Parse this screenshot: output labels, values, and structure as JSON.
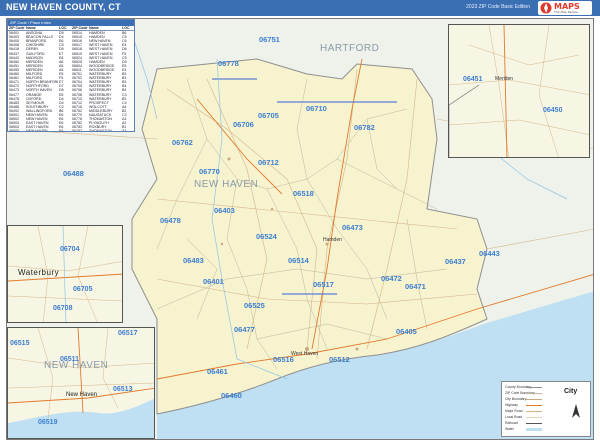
{
  "header": {
    "title": "NEW HAVEN COUNTY, CT",
    "subtitle": "2023 ZIP Code Basic Edition",
    "logo_word": "MAPS",
    "logo_tagline": "The Map People"
  },
  "colors": {
    "header": "#3a6fb3",
    "county_fill": "#f7f3cf",
    "outside_fill": "#eef2ea",
    "water": "#bfe0f2",
    "zip_label": "#3d7fd1",
    "roads": "#d4b48a",
    "boundary": "#8f8f8f"
  },
  "map": {
    "region_labels": {
      "county": "NEW HAVEN",
      "hartford": "HARTFORD",
      "meriden": "Meriden",
      "waterbury": "Waterbury",
      "hamden": "Hamden",
      "west_haven": "West Haven",
      "new_haven": "New Haven"
    },
    "zip_labels": [
      "06751",
      "06705",
      "06710",
      "06778",
      "06706",
      "06762",
      "06782",
      "06770",
      "06712",
      "06488",
      "06518",
      "06403",
      "06478",
      "06483",
      "06524",
      "06514",
      "06473",
      "06401",
      "06517",
      "06472",
      "06525",
      "06471",
      "06477",
      "06405",
      "06516",
      "06512",
      "06461",
      "06437",
      "06443",
      "06450",
      "06451",
      "06460"
    ],
    "inset_zip_labels": {
      "meriden": [
        "06451",
        "06450"
      ],
      "waterbury": [
        "06704",
        "06705",
        "06708"
      ],
      "new_haven": [
        "06515",
        "06517",
        "06511",
        "06513",
        "06519"
      ]
    }
  },
  "zip_table": {
    "title": "ZIP Code / Place Index",
    "columns": [
      "ZIP Code",
      "Name",
      "LOC",
      "ZIP Code",
      "Name",
      "LOC"
    ],
    "rows": [
      [
        "06401",
        "ANSONIA",
        "D5",
        "06514",
        "HAMDEN",
        "B6"
      ],
      [
        "06403",
        "BEACON FALLS",
        "D4",
        "06515",
        "HAMDEN",
        "C5"
      ],
      [
        "06405",
        "BRANFORD",
        "E6",
        "06516",
        "NEW HAVEN",
        "C6"
      ],
      [
        "06408",
        "CHESHIRE",
        "C5",
        "06517",
        "WEST HAVEN",
        "E4"
      ],
      [
        "06418",
        "DERBY",
        "D5",
        "06518",
        "WEST HAVEN",
        "D6"
      ],
      [
        "06437",
        "GUILFORD",
        "E7",
        "06519",
        "WEST HAVEN",
        "F5"
      ],
      [
        "06443",
        "MADISON",
        "E8",
        "06524",
        "WEST HAVEN",
        "C5"
      ],
      [
        "06450",
        "MERIDEN",
        "A6",
        "06525",
        "HAMDEN",
        "D5"
      ],
      [
        "06451",
        "MERIDEN",
        "A5",
        "06604",
        "WOODBRIDGE",
        "E5"
      ],
      [
        "06455",
        "MERIDEN",
        "A5",
        "06611",
        "WOODBRIDGE",
        "E4"
      ],
      [
        "06460",
        "MILFORD",
        "E5",
        "06701",
        "WATERBURY",
        "B3"
      ],
      [
        "06461",
        "MILFORD",
        "F5",
        "06702",
        "WATERBURY",
        "B3"
      ],
      [
        "06471",
        "NORTH BRANFORD",
        "E7",
        "06704",
        "WATERBURY",
        "B3"
      ],
      [
        "06472",
        "NORTHFORD",
        "D7",
        "06705",
        "WATERBURY",
        "B4"
      ],
      [
        "06473",
        "NORTH HAVEN",
        "D6",
        "06706",
        "WATERBURY",
        "B4"
      ],
      [
        "06477",
        "ORANGE",
        "E5",
        "06708",
        "WATERBURY",
        "C3"
      ],
      [
        "06478",
        "OXFORD",
        "D4",
        "06710",
        "WATERBURY",
        "B3"
      ],
      [
        "06483",
        "SEYMOUR",
        "D4",
        "06712",
        "PROSPECT",
        "C4"
      ],
      [
        "06488",
        "SOUTHBURY",
        "C2",
        "06716",
        "WOLCOTT",
        "A4"
      ],
      [
        "06492",
        "WALLINGFORD",
        "B6",
        "06762",
        "MIDDLEBURY",
        "B2"
      ],
      [
        "06501",
        "NEW HAVEN",
        "E6",
        "06770",
        "NAUGATUCK",
        "C3"
      ],
      [
        "06502",
        "NEW HAVEN",
        "E6",
        "06778",
        "THOMASTON",
        "A3"
      ],
      [
        "06503",
        "EAST HAVEN",
        "E6",
        "06782",
        "PLYMOUTH",
        "A2"
      ],
      [
        "06504",
        "EAST HAVEN",
        "E6",
        "06783",
        "ROXBURY",
        "B1"
      ],
      [
        "06505",
        "NEW HAVEN",
        "E6",
        "06787",
        "THOMASTON",
        "A3"
      ],
      [
        "06506",
        "NEW HAVEN",
        "E6",
        "06795",
        "WATERTOWN",
        "B2"
      ],
      [
        "06510",
        "NEW HAVEN",
        "F6",
        "06798",
        "WOODBURY",
        "B1"
      ]
    ]
  },
  "legend": {
    "items": [
      "County Boundary",
      "ZIP Code Boundary",
      "City Boundary",
      "Highway",
      "Major Road",
      "Local Road",
      "Railroad",
      "Water"
    ],
    "city_word": "City"
  }
}
